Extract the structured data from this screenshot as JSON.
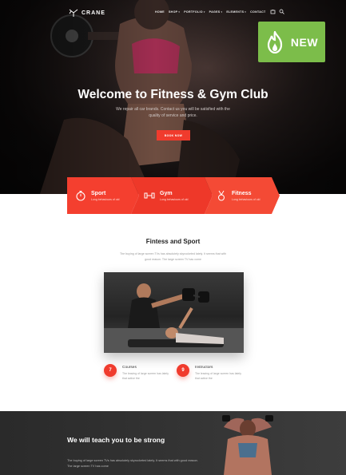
{
  "brand": {
    "name": "CRANE"
  },
  "nav": {
    "items": [
      {
        "label": "HOME",
        "caret": false
      },
      {
        "label": "SHOP",
        "caret": true
      },
      {
        "label": "PORTFOLIO",
        "caret": true
      },
      {
        "label": "PAGES",
        "caret": true
      },
      {
        "label": "ELEMENTS",
        "caret": true
      },
      {
        "label": "CONTACT",
        "caret": false
      }
    ],
    "icons": [
      "cart-icon",
      "search-icon"
    ]
  },
  "badge": {
    "label": "NEW",
    "icon": "flame-icon"
  },
  "hero": {
    "title": "Welcome to Fitness & Gym Club",
    "subtitle": "We repair all car brands. Contact us you will be satisfied with the quality of service and price.",
    "button": "BOOK NOW"
  },
  "features": [
    {
      "title": "Sport",
      "desc": "Long behaviours of old",
      "icon": "stopwatch-icon"
    },
    {
      "title": "Gym",
      "desc": "Long behaviours of old",
      "icon": "dumbbell-icon"
    },
    {
      "title": "Fitness",
      "desc": "Long behaviours of old",
      "icon": "medal-icon"
    }
  ],
  "section": {
    "title": "Fintess and Sport",
    "text": "The buying of large screen TVs has absolutely skyrocketed lately. It seems that with good reason. The large screen TV has come"
  },
  "stats": [
    {
      "number": "7",
      "label": "Courses",
      "desc": "The leaving of large screen has lately that active the"
    },
    {
      "number": "9",
      "label": "Instructors",
      "desc": "The leaving of large screen has lately that active the"
    }
  ],
  "bottom": {
    "title": "We will teach you to be strong",
    "text": "The buying of large screen TVs has absolutely skyrocketed lately. It seems that with good reason. The large screen TV has come"
  },
  "colors": {
    "accent": "#f03b2d",
    "badge": "#7cbd4a",
    "dark": "#0f0c0c"
  }
}
